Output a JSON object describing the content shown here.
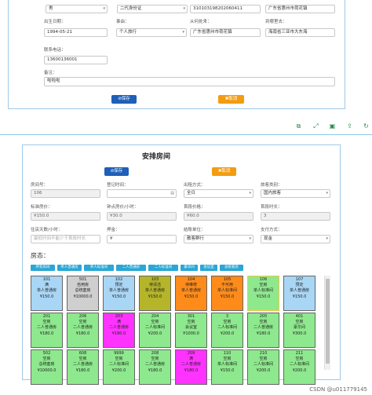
{
  "top_form": {
    "row1": {
      "gender_value": "男",
      "idtype_value": "二代身份证",
      "idnum_value": "310103198202060411",
      "address_value": "广东省惠州市荷花镇"
    },
    "row2": {
      "birth_label": "出生日期：",
      "birth_value": "1994-05-21",
      "reason_label": "事由：",
      "reason_value": "个人旅行",
      "from_label": "从何处来：",
      "from_value": "广东省惠州市荷花镇",
      "to_label": "到哪里去：",
      "to_value": "海南省三亚市大东海"
    },
    "phone_label": "联系电话：",
    "phone_value": "13600136001",
    "remark_label": "备注：",
    "remark_value": "啦啦啦",
    "save_label": "⊘保存",
    "cancel_label": "✖取消"
  },
  "toolbar_icons": [
    "copy-icon",
    "expand-icon",
    "save-icon",
    "export-icon",
    "refresh-icon"
  ],
  "arrange": {
    "title": "安排房间",
    "save_label": "⊘保存",
    "cancel_label": "✖取消",
    "fields": {
      "room_no_label": "房间号：",
      "room_no_value": "106",
      "checkin_time_label": "登记时间：",
      "rent_type_label": "出租方式：",
      "rent_type_value": "全日",
      "guest_type_label": "旅客类别：",
      "guest_type_value": "国内旅客",
      "std_price_label": "标准房价：",
      "std_price_value": "¥150.0",
      "hourly_label": "钟点房价/小时：",
      "hourly_value": "¥30.0",
      "first_price_label": "首段价格：",
      "first_price_value": "¥60.0",
      "first_hours_label": "首段时长：",
      "first_hours_value": "3",
      "days_label": "住店天数/小时：",
      "days_placeholder": "最低时间不能少于首段时长",
      "deposit_label": "押金：",
      "deposit_value": "¥",
      "settle_label": "结账单位：",
      "settle_value": "散客群行",
      "pay_label": "支付方式：",
      "pay_value": "现金"
    },
    "status_label": "房态：",
    "tabs": [
      "所有房间",
      "单人普通房",
      "单人标准间",
      "二人普通房",
      "二人标准间",
      "豪华间",
      "会议室",
      "总统套房"
    ],
    "colors": {
      "green": "#8ee88e",
      "grey": "#cfcfcf",
      "blue": "#a9d6f5",
      "olive": "#b5b52a",
      "orange": "#ff8c1a",
      "magenta": "#ff33ff",
      "selected": "#f5c542",
      "accent_blue": "#1e5fb8",
      "accent_orange": "#f39c12"
    },
    "rooms": [
      {
        "no": "101",
        "status": "满",
        "type": "单人普通房",
        "price": "¥150.0",
        "color": "blue"
      },
      {
        "no": "501",
        "status": "自用房",
        "type": "总统套房",
        "price": "¥10000.0",
        "color": "grey"
      },
      {
        "no": "102",
        "status": "预定",
        "type": "单人普通房",
        "price": "¥150.0",
        "color": "blue"
      },
      {
        "no": "103",
        "status": "待清洁",
        "type": "单人普通房",
        "price": "¥150.0",
        "color": "olive"
      },
      {
        "no": "104",
        "status": "待维修",
        "type": "单人普通房",
        "price": "¥150.0",
        "color": "orange"
      },
      {
        "no": "105",
        "status": "不可用",
        "type": "单人标准间",
        "price": "¥150.0",
        "color": "orange"
      },
      {
        "no": "106",
        "status": "空房",
        "type": "单人标准间",
        "price": "¥150.0",
        "color": "green"
      },
      {
        "no": "107",
        "status": "预定",
        "type": "单人普通房",
        "price": "¥150.0",
        "color": "blue"
      },
      {
        "no": "201",
        "status": "空房",
        "type": "二人普通房",
        "price": "¥180.0",
        "color": "green"
      },
      {
        "no": "206",
        "status": "空房",
        "type": "二人普通房",
        "price": "¥180.0",
        "color": "green"
      },
      {
        "no": "203",
        "status": "满",
        "type": "二人普通房",
        "price": "¥180.0",
        "color": "magenta"
      },
      {
        "no": "204",
        "status": "空房",
        "type": "二人标准间",
        "price": "¥200.0",
        "color": "green"
      },
      {
        "no": "301",
        "status": "空房",
        "type": "会议室",
        "price": "¥1000.0",
        "color": "green"
      },
      {
        "no": "3",
        "status": "空房",
        "type": "二人标准间",
        "price": "¥200.0",
        "color": "green"
      },
      {
        "no": "205",
        "status": "空房",
        "type": "二人普通房",
        "price": "¥180.0",
        "color": "green"
      },
      {
        "no": "401",
        "status": "空房",
        "type": "豪华间",
        "price": "¥300.0",
        "color": "green"
      },
      {
        "no": "502",
        "status": "空房",
        "type": "总统套房",
        "price": "¥10000.0",
        "color": "green"
      },
      {
        "no": "608",
        "status": "空房",
        "type": "二人普通房",
        "price": "¥180.0",
        "color": "green"
      },
      {
        "no": "9999",
        "status": "空房",
        "type": "二人标准间",
        "price": "¥200.0",
        "color": "green"
      },
      {
        "no": "208",
        "status": "空房",
        "type": "二人普通房",
        "price": "¥180.0",
        "color": "green"
      },
      {
        "no": "209",
        "status": "满",
        "type": "二人普通房",
        "price": "¥180.0",
        "color": "magenta"
      },
      {
        "no": "110",
        "status": "空房",
        "type": "单人标准间",
        "price": "¥150.0",
        "color": "green"
      },
      {
        "no": "210",
        "status": "空房",
        "type": "二人标准间",
        "price": "¥200.0",
        "color": "green"
      },
      {
        "no": "211",
        "status": "空房",
        "type": "二人标准间",
        "price": "¥200.0",
        "color": "green"
      }
    ]
  },
  "watermark": "CSDN @u011779145"
}
